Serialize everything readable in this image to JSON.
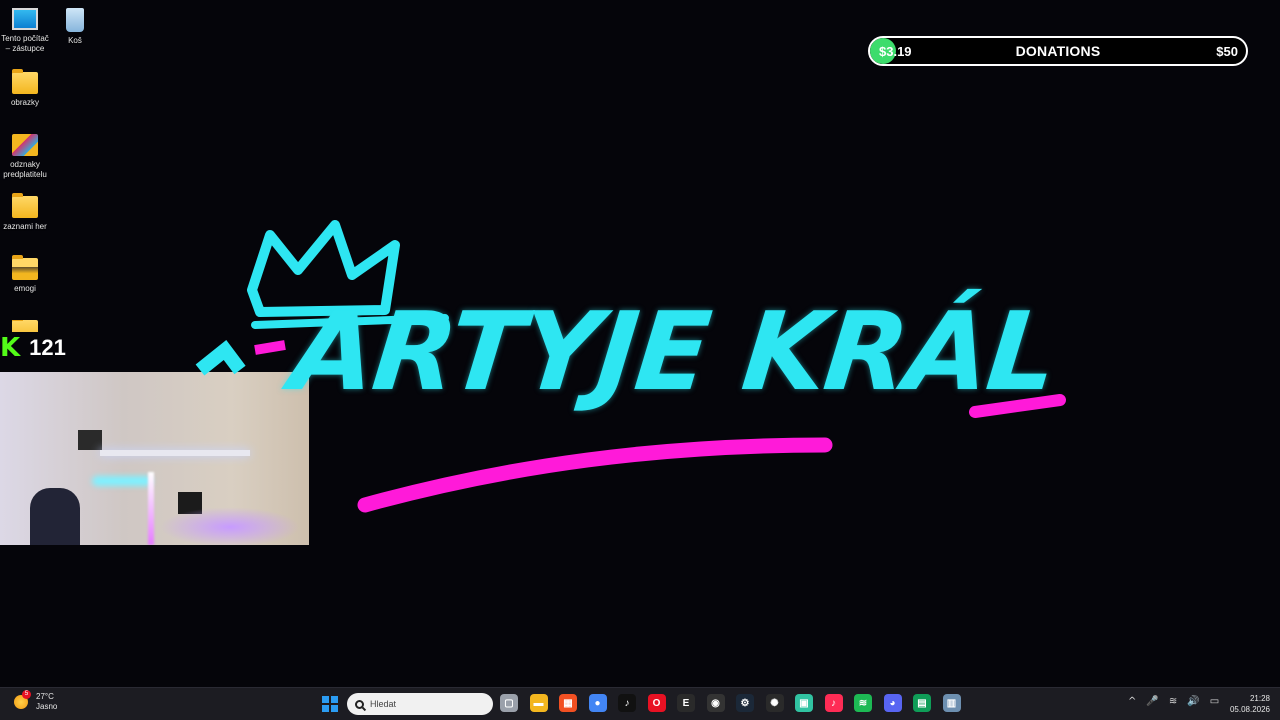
{
  "desktop": {
    "icons": [
      {
        "name": "this-pc",
        "label": "Tento počítač – zástupce"
      },
      {
        "name": "recycle-bin",
        "label": "Koš"
      },
      {
        "name": "folder-obrazky",
        "label": "obrazky"
      },
      {
        "name": "folder-odznaky",
        "label": "odznaky predplatitelu"
      },
      {
        "name": "folder-zaznami",
        "label": "zaznami her"
      },
      {
        "name": "folder-emogi",
        "label": "emogi"
      }
    ]
  },
  "overlay": {
    "kick_letter": "K",
    "viewer_count": "121",
    "donations": {
      "current": "$3.19",
      "title": "DONATIONS",
      "goal": "$50",
      "progress_fraction": 0.064,
      "fill_color": "#3ddc6c"
    },
    "logo": {
      "text": "ARTYJE KRÁL",
      "accent_cyan": "#2ee6f2",
      "accent_magenta": "#ff1ad9"
    }
  },
  "taskbar": {
    "weather": {
      "temp": "27°C",
      "condition": "Jasno",
      "badge": "5"
    },
    "search_placeholder": "Hledat",
    "apps": [
      {
        "icon": "task-view-icon",
        "color": "#9aa0aa",
        "glyph": "▢"
      },
      {
        "icon": "file-explorer-icon",
        "color": "#f3b61f",
        "glyph": "▬"
      },
      {
        "icon": "microsoft-store-icon",
        "color": "#f25022",
        "glyph": "▦"
      },
      {
        "icon": "chrome-icon",
        "color": "#4285f4",
        "glyph": "●"
      },
      {
        "icon": "tiktok-icon",
        "color": "#111111",
        "glyph": "♪"
      },
      {
        "icon": "opera-icon",
        "color": "#e81123",
        "glyph": "O"
      },
      {
        "icon": "epic-games-icon",
        "color": "#2a2a2a",
        "glyph": "E"
      },
      {
        "icon": "obs-icon",
        "color": "#333333",
        "glyph": "◉"
      },
      {
        "icon": "steam-icon",
        "color": "#1b2838",
        "glyph": "⚙"
      },
      {
        "icon": "chatgpt-icon",
        "color": "#2a2a2a",
        "glyph": "✺"
      },
      {
        "icon": "streamlabs-icon",
        "color": "#31c3a2",
        "glyph": "▣"
      },
      {
        "icon": "tiktok-live-icon",
        "color": "#fe2c55",
        "glyph": "♪"
      },
      {
        "icon": "spotify-icon",
        "color": "#1db954",
        "glyph": "≋"
      },
      {
        "icon": "discord-icon",
        "color": "#5865f2",
        "glyph": "◕"
      },
      {
        "icon": "sheets-icon",
        "color": "#0f9d58",
        "glyph": "▤"
      },
      {
        "icon": "app-window-icon",
        "color": "#6d8fb0",
        "glyph": "▥"
      }
    ],
    "tray": [
      "^",
      "🎤",
      "wifi",
      "🔊",
      "🔋"
    ],
    "clock": {
      "time": "21:28",
      "date": "05.08.2026"
    }
  }
}
